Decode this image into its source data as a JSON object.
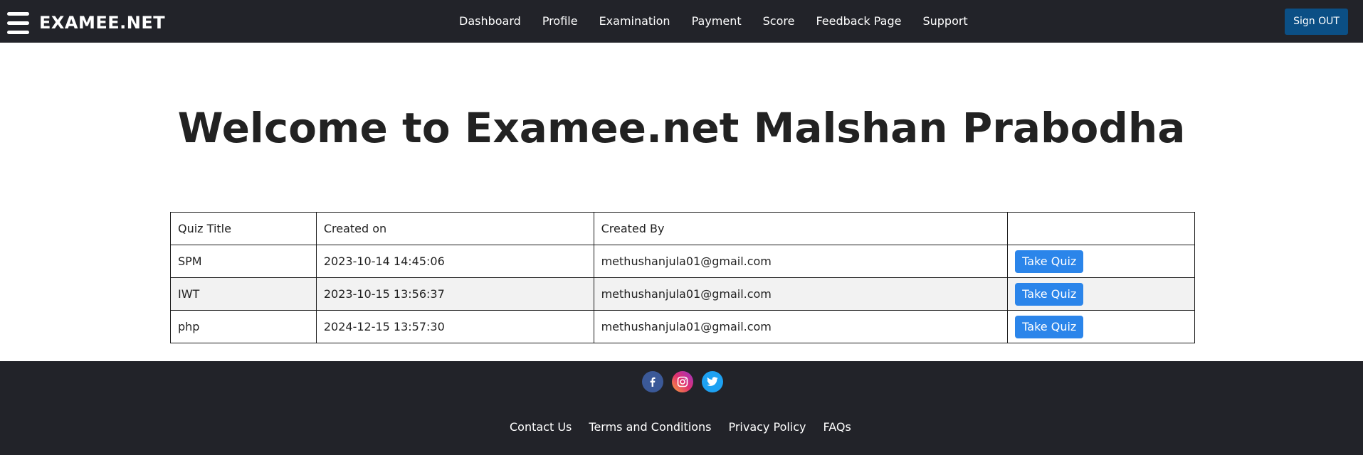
{
  "header": {
    "brand": "EXAMEE.NET",
    "nav": [
      "Dashboard",
      "Profile",
      "Examination",
      "Payment",
      "Score",
      "Feedback Page",
      "Support"
    ],
    "signout_label": "Sign OUT",
    "menu_icon": "hamburger-menu-icon"
  },
  "main": {
    "welcome": "Welcome to Examee.net Malshan Prabodha",
    "table": {
      "headers": [
        "Quiz Title",
        "Created on",
        "Created By",
        ""
      ],
      "rows": [
        {
          "title": "SPM",
          "created_on": "2023-10-14 14:45:06",
          "created_by": "methushanjula01@gmail.com",
          "action": "Take Quiz"
        },
        {
          "title": "IWT",
          "created_on": "2023-10-15 13:56:37",
          "created_by": "methushanjula01@gmail.com",
          "action": "Take Quiz"
        },
        {
          "title": "php",
          "created_on": "2024-12-15 13:57:30",
          "created_by": "methushanjula01@gmail.com",
          "action": "Take Quiz"
        }
      ]
    }
  },
  "footer": {
    "social": [
      "facebook-icon",
      "instagram-icon",
      "twitter-icon"
    ],
    "links": [
      "Contact Us",
      "Terms and Conditions",
      "Privacy Policy",
      "FAQs"
    ]
  },
  "colors": {
    "nav_bg": "#222329",
    "signout_bg": "#0b4f85",
    "button_blue": "#2b85ea",
    "stripe": "#f2f2f2"
  }
}
